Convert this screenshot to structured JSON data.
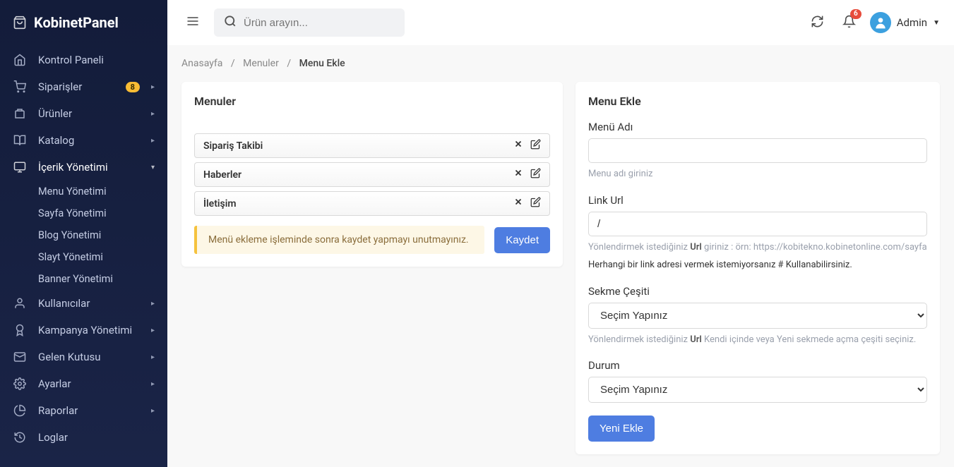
{
  "brand": "KobinetPanel",
  "search": {
    "placeholder": "Ürün arayın..."
  },
  "notifications": {
    "count": "6"
  },
  "user": {
    "name": "Admin"
  },
  "sidebar": {
    "items": [
      {
        "label": "Kontrol Paneli",
        "badge": null,
        "caret": false
      },
      {
        "label": "Siparişler",
        "badge": "8",
        "caret": true
      },
      {
        "label": "Ürünler",
        "badge": null,
        "caret": true
      },
      {
        "label": "Katalog",
        "badge": null,
        "caret": true
      },
      {
        "label": "İçerik Yönetimi",
        "badge": null,
        "caret": true,
        "expanded": true,
        "children": [
          "Menu Yönetimi",
          "Sayfa Yönetimi",
          "Blog Yönetimi",
          "Slayt Yönetimi",
          "Banner Yönetimi"
        ]
      },
      {
        "label": "Kullanıcılar",
        "badge": null,
        "caret": true
      },
      {
        "label": "Kampanya Yönetimi",
        "badge": null,
        "caret": true
      },
      {
        "label": "Gelen Kutusu",
        "badge": null,
        "caret": true
      },
      {
        "label": "Ayarlar",
        "badge": null,
        "caret": true
      },
      {
        "label": "Raporlar",
        "badge": null,
        "caret": true
      },
      {
        "label": "Loglar",
        "badge": null,
        "caret": false
      }
    ]
  },
  "breadcrumb": {
    "home": "Anasayfa",
    "mid": "Menuler",
    "active": "Menu Ekle"
  },
  "left": {
    "title": "Menuler",
    "items": [
      "Sipariş Takibi",
      "Haberler",
      "İletişim"
    ],
    "alert": "Menü ekleme işleminde sonra kaydet yapmayı unutmayınız.",
    "save": "Kaydet"
  },
  "right": {
    "title": "Menu Ekle",
    "name_label": "Menü Adı",
    "name_help": "Menu adı giriniz",
    "url_label": "Link Url",
    "url_value": "/",
    "url_help1_a": "Yönlendirmek istediğiniz ",
    "url_help1_b": "Url",
    "url_help1_c": " giriniz : örn: https://kobitekno.kobinetonline.com/sayfa",
    "url_help2_a": "Herhangi bir link adresi vermek istemiyorsanız ",
    "url_help2_b": "#",
    "url_help2_c": " Kullanabilirsiniz.",
    "tab_label": "Sekme Çeşiti",
    "tab_value": "Seçim Yapınız",
    "tab_help_a": "Yönlendirmek istediğiniz ",
    "tab_help_b": "Url",
    "tab_help_c": " Kendi içinde veya Yeni sekmede açma çeşiti seçiniz.",
    "status_label": "Durum",
    "status_value": "Seçim Yapınız",
    "submit": "Yeni Ekle"
  }
}
